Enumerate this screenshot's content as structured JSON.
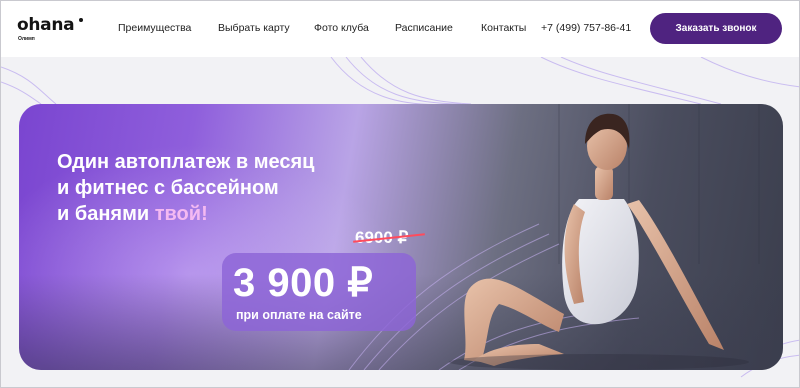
{
  "logo": {
    "name": "ohana",
    "sub": "Олимп"
  },
  "nav": {
    "items": [
      "Преимущества",
      "Выбрать карту",
      "Фото клуба",
      "Расписание",
      "Контакты"
    ]
  },
  "phone": "+7 (499) 757-86-41",
  "cta_label": "Заказать звонок",
  "hero": {
    "headline_1": "Один автоплатеж в месяц",
    "headline_2": "и фитнес с бассейном",
    "headline_3a": "и банями ",
    "headline_3b": "твой!",
    "old_price": "6900 ₽",
    "price": "3 900 ₽",
    "price_note": "при оплате на сайте"
  },
  "colors": {
    "brand": "#4f2380",
    "accent_text": "#f4b9f2",
    "strike": "#ff4b5c",
    "hero_purple": "#7a45d0"
  }
}
